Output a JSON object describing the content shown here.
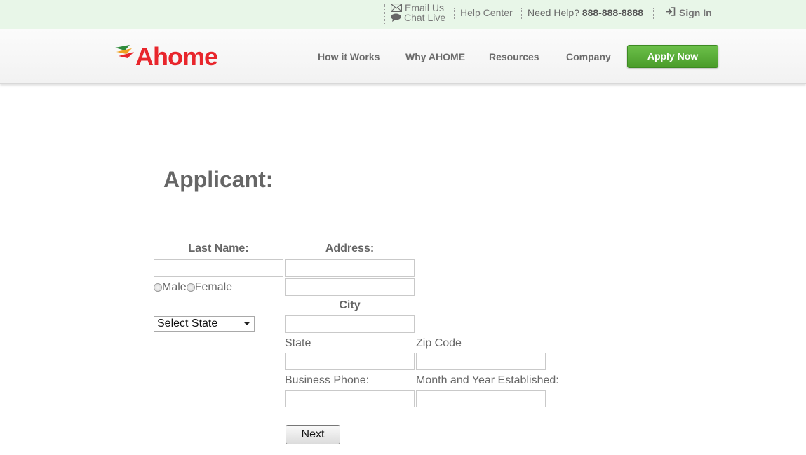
{
  "topbar": {
    "email_label": "Email Us",
    "chat_label": "Chat Live",
    "help_center": "Help Center",
    "need_help_label": "Need Help?",
    "phone": "888-888-8888",
    "sign_in": "Sign In"
  },
  "header": {
    "logo_text": "Ahome",
    "nav": [
      "How it Works",
      "Why AHOME",
      "Resources",
      "Company"
    ],
    "apply_label": "Apply Now"
  },
  "form": {
    "title": "Applicant:",
    "last_name_label": "Last Name:",
    "address_label": "Address:",
    "gender_options": [
      "Male",
      "Female"
    ],
    "city_label": "City",
    "state_select": "Select State",
    "state_label": "State",
    "zip_label": "Zip Code",
    "business_phone_label": "Business Phone:",
    "established_label": "Month and Year Established:",
    "next_label": "Next"
  },
  "colors": {
    "topbar_bg": "#e8f6e8",
    "brand_red": "#e8262c",
    "apply_green": "#5aaf38"
  }
}
